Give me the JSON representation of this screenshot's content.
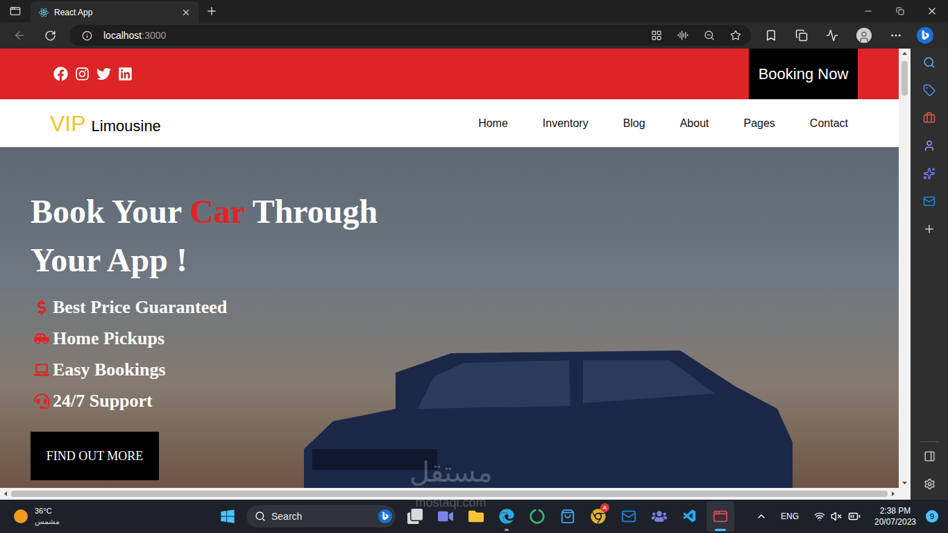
{
  "browser": {
    "tab": {
      "title": "React App"
    },
    "address": {
      "host": "localhost",
      "port": ":3000"
    }
  },
  "page": {
    "top_bar": {
      "button": "Booking Now"
    },
    "logo": {
      "accent": "VIP",
      "name": "Limousine"
    },
    "nav": [
      {
        "label": "Home"
      },
      {
        "label": "Inventory"
      },
      {
        "label": "Blog"
      },
      {
        "label": "About"
      },
      {
        "label": "Pages"
      },
      {
        "label": "Contact"
      }
    ],
    "hero": {
      "title_before": "Book Your ",
      "title_accent": "Car",
      "title_after": " Through",
      "title_line2": "Your App !",
      "features": [
        "Best Price Guaranteed",
        "Home Pickups",
        "Easy Bookings",
        "24/7 Support"
      ],
      "button": "FIND OUT MORE"
    }
  },
  "taskbar": {
    "weather": {
      "temp": "36°C",
      "condition": "مشمس"
    },
    "search": {
      "placeholder": "Search"
    },
    "apps": [
      {
        "running": false,
        "selected": false
      },
      {
        "running": false,
        "selected": false
      },
      {
        "running": false,
        "selected": false
      },
      {
        "running": true,
        "selected": false
      },
      {
        "running": false,
        "selected": false
      },
      {
        "running": false,
        "selected": false
      },
      {
        "running": false,
        "selected": false,
        "badge": "A"
      },
      {
        "running": false,
        "selected": false
      },
      {
        "running": false,
        "selected": false
      },
      {
        "running": false,
        "selected": false
      },
      {
        "running": true,
        "selected": true
      }
    ],
    "tray": {
      "language": "ENG",
      "time": "2:38 PM",
      "date": "20/07/2023",
      "notifications": "9"
    }
  },
  "watermark": {
    "arabic": "مستقل",
    "latin": "mostaql.com"
  }
}
